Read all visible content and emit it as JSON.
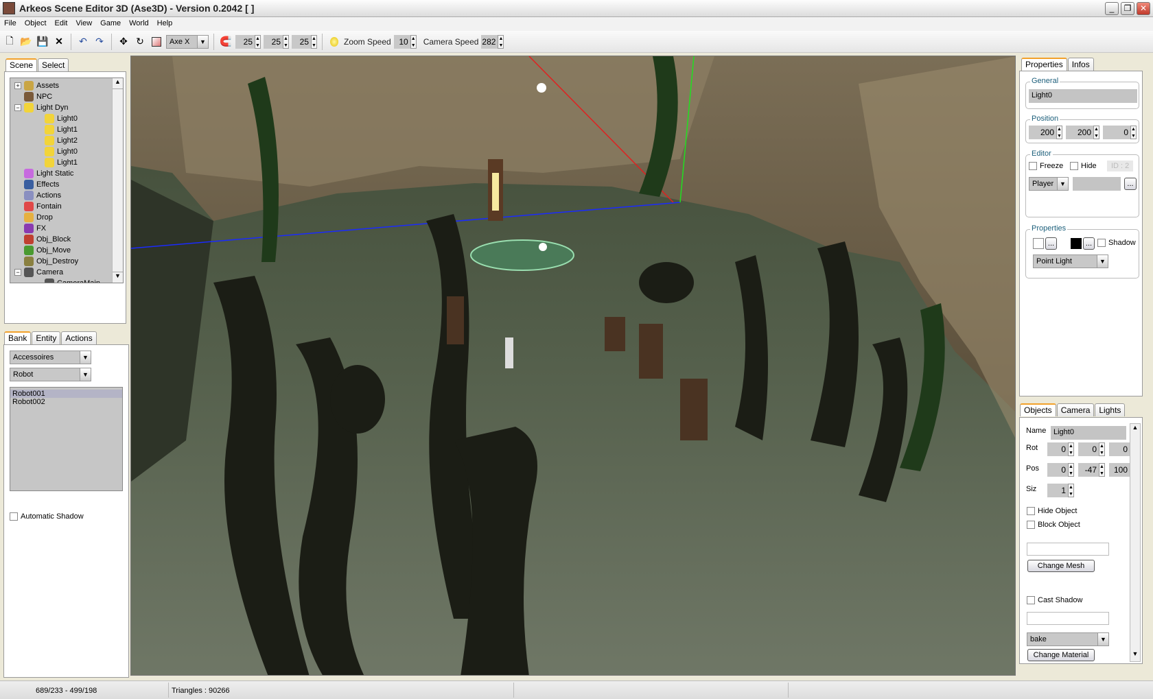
{
  "window": {
    "title": "Arkeos Scene Editor 3D (Ase3D) - Version 0.2042 [ ]",
    "minimize": "_",
    "maximize": "❐",
    "close": "✕"
  },
  "menu": [
    "File",
    "Object",
    "Edit",
    "View",
    "Game",
    "World",
    "Help"
  ],
  "toolbar": {
    "axis": "Axe X",
    "snap": [
      "25",
      "25",
      "25"
    ],
    "zoom_speed_label": "Zoom Speed",
    "zoom_speed": "10",
    "camera_speed_label": "Camera Speed",
    "camera_speed": "282"
  },
  "left": {
    "tabs": [
      "Scene",
      "Select"
    ],
    "tree": [
      {
        "label": "Assets",
        "depth": 0,
        "exp": "+",
        "color": "#c9a545"
      },
      {
        "label": "NPC",
        "depth": 0,
        "exp": "",
        "color": "#7a5a3a"
      },
      {
        "label": "Light Dyn",
        "depth": 0,
        "exp": "−",
        "color": "#f2d43a"
      },
      {
        "label": "Light0",
        "depth": 1,
        "exp": "",
        "color": "#f2d43a"
      },
      {
        "label": "Light1",
        "depth": 1,
        "exp": "",
        "color": "#f2d43a"
      },
      {
        "label": "Light2",
        "depth": 1,
        "exp": "",
        "color": "#f2d43a"
      },
      {
        "label": "Light0",
        "depth": 1,
        "exp": "",
        "color": "#f2d43a"
      },
      {
        "label": "Light1",
        "depth": 1,
        "exp": "",
        "color": "#f2d43a"
      },
      {
        "label": "Light Static",
        "depth": 0,
        "exp": "",
        "color": "#c76adf"
      },
      {
        "label": "Effects",
        "depth": 0,
        "exp": "",
        "color": "#3a5fa0"
      },
      {
        "label": "Actions",
        "depth": 0,
        "exp": "",
        "color": "#8a8fc0"
      },
      {
        "label": "Fontain",
        "depth": 0,
        "exp": "",
        "color": "#e04848"
      },
      {
        "label": "Drop",
        "depth": 0,
        "exp": "",
        "color": "#e6b040"
      },
      {
        "label": "FX",
        "depth": 0,
        "exp": "",
        "color": "#8a3ab0"
      },
      {
        "label": "Obj_Block",
        "depth": 0,
        "exp": "",
        "color": "#c04030"
      },
      {
        "label": "Obj_Move",
        "depth": 0,
        "exp": "",
        "color": "#4a9a30"
      },
      {
        "label": "Obj_Destroy",
        "depth": 0,
        "exp": "",
        "color": "#8a8040"
      },
      {
        "label": "Camera",
        "depth": 0,
        "exp": "−",
        "color": "#555"
      },
      {
        "label": "CameraMain",
        "depth": 1,
        "exp": "",
        "color": "#555"
      }
    ],
    "bank_tabs": [
      "Bank",
      "Entity",
      "Actions"
    ],
    "category": "Accessoires",
    "subcategory": "Robot",
    "bank_items": [
      "Robot001",
      "Robot002"
    ],
    "auto_shadow": "Automatic Shadow"
  },
  "right": {
    "tabs": [
      "Properties",
      "Infos"
    ],
    "general": {
      "title": "General",
      "name": "Light0"
    },
    "position": {
      "title": "Position",
      "values": [
        "200",
        "200",
        "0"
      ]
    },
    "editor": {
      "title": "Editor",
      "freeze": "Freeze",
      "hide": "Hide",
      "id": "ID : 2",
      "owner": "Player",
      "browse": "..."
    },
    "properties": {
      "title": "Properties",
      "browse": "...",
      "shadow": "Shadow",
      "light_type": "Point Light"
    },
    "obj_tabs": [
      "Objects",
      "Camera",
      "Lights"
    ],
    "obj": {
      "name_label": "Name",
      "name": "Light0",
      "rot_label": "Rot",
      "rot": [
        "0",
        "0",
        "0"
      ],
      "pos_label": "Pos",
      "pos": [
        "0",
        "-47",
        "100"
      ],
      "siz_label": "Siz",
      "siz": "1",
      "hide": "Hide Object",
      "block": "Block Object",
      "change_mesh": "Change Mesh",
      "cast_shadow": "Cast Shadow",
      "material": "bake",
      "change_material": "Change Material"
    }
  },
  "status": {
    "coords": "689/233 - 499/198",
    "triangles": "Triangles : 90266"
  }
}
